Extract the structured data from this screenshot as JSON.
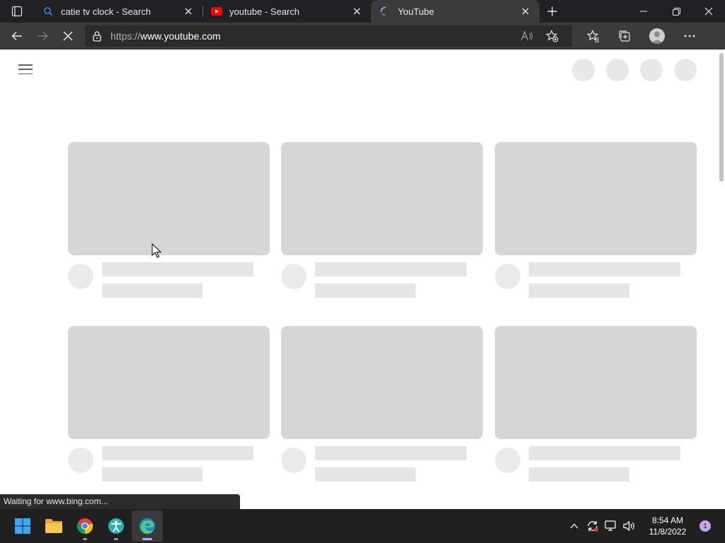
{
  "browser": {
    "tabs": [
      {
        "title": "catie tv clock - Search",
        "icon": "bing-search-icon",
        "active": false
      },
      {
        "title": "youtube - Search",
        "icon": "youtube-icon",
        "active": false
      },
      {
        "title": "YouTube",
        "icon": "loading-spinner-icon",
        "active": true
      }
    ],
    "address": {
      "protocol": "https://",
      "host": "www.youtube.com"
    },
    "status_text": "Waiting for www.bing.com..."
  },
  "page": {
    "skeleton_cards": 6
  },
  "taskbar": {
    "apps": [
      "start-icon",
      "file-explorer-icon",
      "chrome-icon",
      "accessibility-app-icon",
      "edge-icon"
    ],
    "time": "8:54 AM",
    "date": "11/8/2022",
    "notification_count": "1"
  },
  "colors": {
    "tabstrip_bg": "#202124",
    "toolbar_bg": "#3b3b3b",
    "skeleton_thumb": "#d6d6d6",
    "skeleton_text": "#e5e5e5",
    "taskbar_bg": "#202020",
    "accent": "#c7a4f5"
  }
}
